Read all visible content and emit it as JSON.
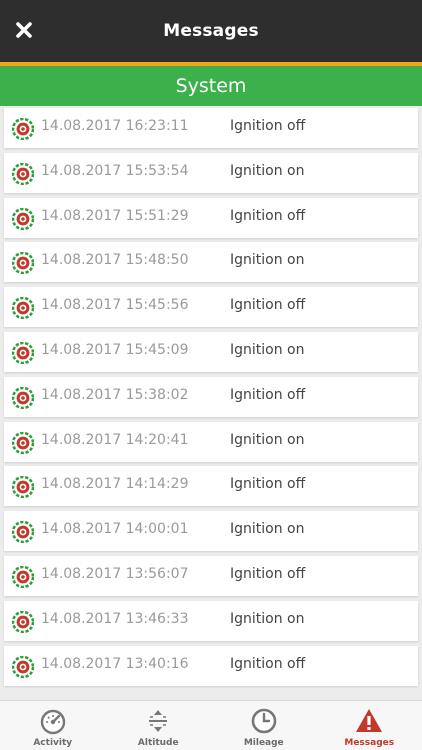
{
  "header": {
    "title": "Messages",
    "close_icon": "close-icon",
    "background_color": "#2e2e2e",
    "accent_color": "#f2a71b"
  },
  "section": {
    "title": "System",
    "color": "#3cb04b"
  },
  "messages": [
    {
      "timestamp": "14.08.2017 16:23:11",
      "text": "Ignition off",
      "icon": "ignition-status-icon"
    },
    {
      "timestamp": "14.08.2017 15:53:54",
      "text": "Ignition on",
      "icon": "ignition-status-icon"
    },
    {
      "timestamp": "14.08.2017 15:51:29",
      "text": "Ignition off",
      "icon": "ignition-status-icon"
    },
    {
      "timestamp": "14.08.2017 15:48:50",
      "text": "Ignition on",
      "icon": "ignition-status-icon"
    },
    {
      "timestamp": "14.08.2017 15:45:56",
      "text": "Ignition off",
      "icon": "ignition-status-icon"
    },
    {
      "timestamp": "14.08.2017 15:45:09",
      "text": "Ignition on",
      "icon": "ignition-status-icon"
    },
    {
      "timestamp": "14.08.2017 15:38:02",
      "text": "Ignition off",
      "icon": "ignition-status-icon"
    },
    {
      "timestamp": "14.08.2017 14:20:41",
      "text": "Ignition on",
      "icon": "ignition-status-icon"
    },
    {
      "timestamp": "14.08.2017 14:14:29",
      "text": "Ignition off",
      "icon": "ignition-status-icon"
    },
    {
      "timestamp": "14.08.2017 14:00:01",
      "text": "Ignition on",
      "icon": "ignition-status-icon"
    },
    {
      "timestamp": "14.08.2017 13:56:07",
      "text": "Ignition off",
      "icon": "ignition-status-icon"
    },
    {
      "timestamp": "14.08.2017 13:46:33",
      "text": "Ignition on",
      "icon": "ignition-status-icon"
    },
    {
      "timestamp": "14.08.2017 13:40:16",
      "text": "Ignition off",
      "icon": "ignition-status-icon"
    }
  ],
  "tabs": [
    {
      "label": "Activity",
      "icon": "speedometer-icon",
      "active": false
    },
    {
      "label": "Altitude",
      "icon": "altitude-icon",
      "active": false
    },
    {
      "label": "Mileage",
      "icon": "clock-icon",
      "active": false
    },
    {
      "label": "Messages",
      "icon": "warning-icon",
      "active": true
    }
  ],
  "colors": {
    "active_tab": "#c0392b",
    "inactive_tab": "#6b6b6b"
  }
}
